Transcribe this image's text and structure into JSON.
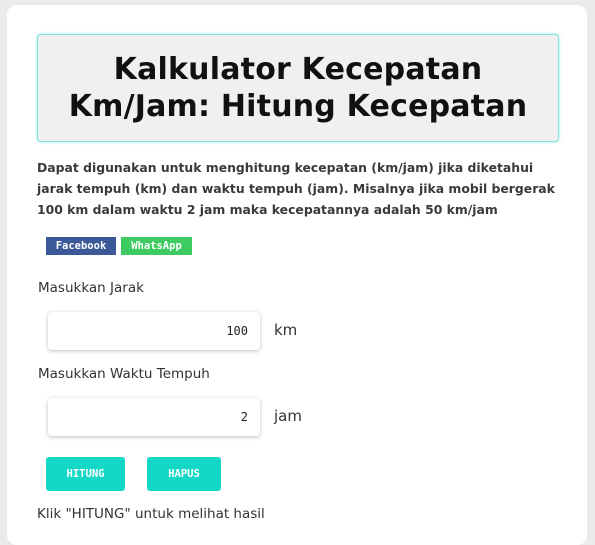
{
  "header": {
    "title_line1": "Kalkulator Kecepatan",
    "title_line2": "Km/Jam: Hitung Kecepatan"
  },
  "description": "Dapat digunakan untuk menghitung kecepatan (km/jam) jika diketahui jarak tempuh (km) dan waktu tempuh (jam). Misalnya jika mobil bergerak 100 km dalam waktu 2 jam maka kecepatannya adalah 50 km/jam",
  "share": {
    "facebook_label": "Facebook",
    "whatsapp_label": "WhatsApp",
    "facebook_color": "#3b5998",
    "whatsapp_color": "#3ecb61"
  },
  "form": {
    "distance": {
      "label": "Masukkan Jarak",
      "value": "100",
      "unit": "km"
    },
    "time": {
      "label": "Masukkan Waktu Tempuh",
      "value": "2",
      "unit": "jam"
    }
  },
  "buttons": {
    "calculate_label": "HITUNG",
    "clear_label": "HAPUS",
    "color": "#13d8c6"
  },
  "result_text": "Klik \"HITUNG\" untuk melihat hasil"
}
